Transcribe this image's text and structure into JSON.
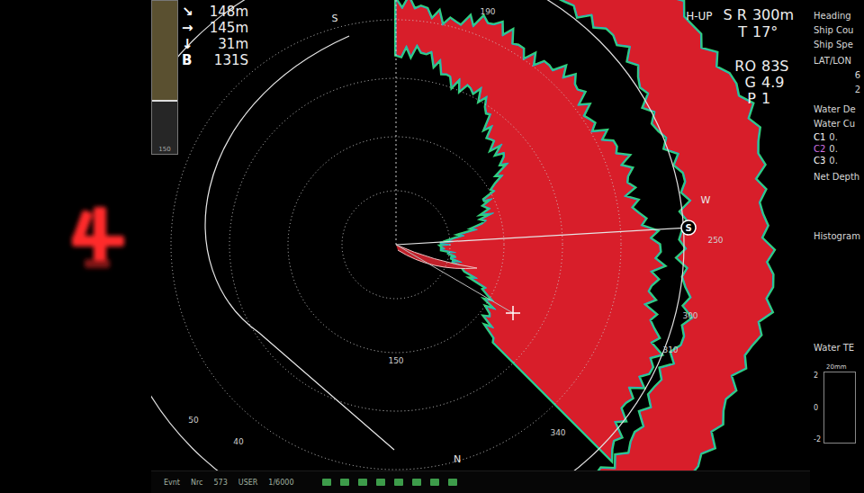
{
  "gauge": {
    "level": 0.28,
    "label": "150"
  },
  "readouts": [
    {
      "symbol": "↘",
      "value": "148m"
    },
    {
      "symbol": "→",
      "value": "145m"
    },
    {
      "symbol": "↓",
      "value": "31m"
    },
    {
      "symbol": "B",
      "value": "131S"
    }
  ],
  "mode": {
    "orientation": "H-UP",
    "range_label": "S R",
    "range": "300m",
    "tilt_label": "T",
    "tilt": "17°"
  },
  "settings": [
    {
      "label": "RO",
      "value": "83S"
    },
    {
      "label": "G",
      "value": "4.9"
    },
    {
      "label": "P",
      "value": "1"
    }
  ],
  "compass_labels": [
    "S",
    "190",
    "W",
    "N",
    "150",
    "250",
    "300",
    "310",
    "340",
    "50",
    "40"
  ],
  "target_marker": {
    "symbol": "S"
  },
  "info_panel": {
    "sections": [
      {
        "lines": [
          {
            "kind": "label",
            "text": "Heading"
          },
          {
            "kind": "label",
            "text": "Ship Cou"
          },
          {
            "kind": "label",
            "text": "Ship Spe"
          }
        ]
      },
      {
        "lines": [
          {
            "kind": "label",
            "text": "LAT/LON"
          },
          {
            "kind": "value",
            "text": "6"
          },
          {
            "kind": "value",
            "text": "2"
          }
        ]
      },
      {
        "lines": [
          {
            "kind": "label",
            "text": "Water De"
          },
          {
            "kind": "label",
            "text": "Water Cu"
          },
          {
            "kind": "current",
            "label": "C1",
            "text": "0.",
            "color": "#ffffff"
          },
          {
            "kind": "current",
            "label": "C2",
            "text": "0.",
            "color": "#d070e0"
          },
          {
            "kind": "current",
            "label": "C3",
            "text": "0.",
            "color": "#ffffff"
          }
        ]
      },
      {
        "lines": [
          {
            "kind": "label",
            "text": "Net Depth"
          }
        ]
      },
      {
        "lines": [
          {
            "kind": "label",
            "text": "Histogram"
          }
        ]
      },
      {
        "lines": [
          {
            "kind": "label",
            "text": "Water TE"
          }
        ]
      }
    ]
  },
  "chart": {
    "unit": "20mm",
    "ticks": [
      "2",
      "0",
      "-2"
    ]
  },
  "toolbar": {
    "items": [
      "Evnt",
      "Nrc",
      "573",
      "USER",
      "1/6000"
    ]
  }
}
